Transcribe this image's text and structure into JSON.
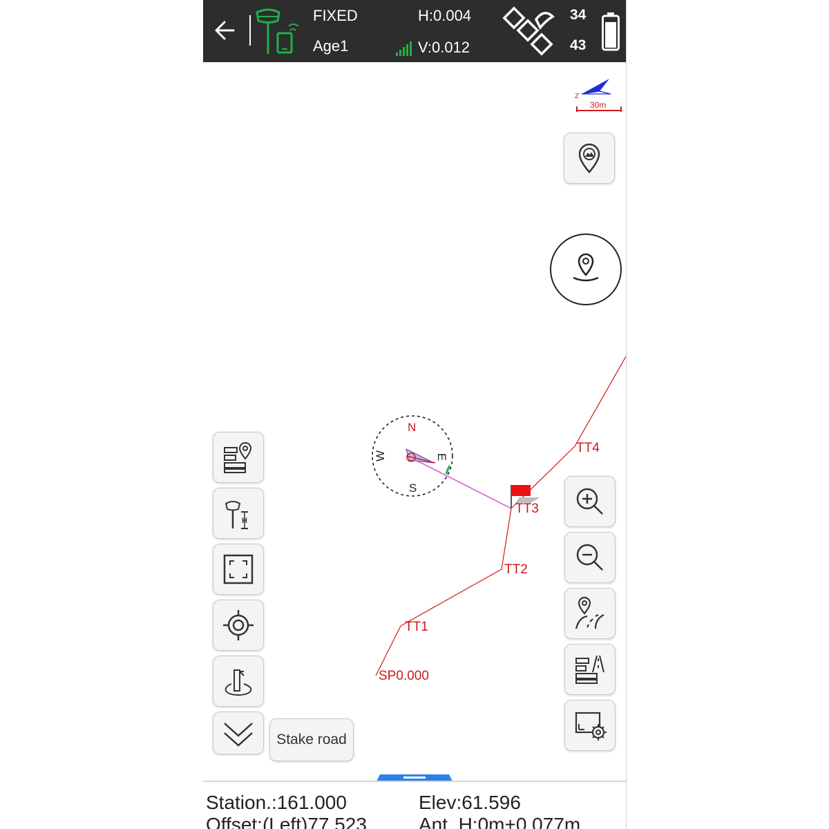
{
  "status_bar": {
    "solution": "FIXED",
    "age": "Age1",
    "h_precision": "H:0.004",
    "v_precision": "V:0.012",
    "satellites_used": "34",
    "satellites_visible": "43",
    "icons": {
      "back": "back-arrow-icon",
      "receiver": "gnss-receiver-icon",
      "signal": "signal-bars-icon",
      "satellite": "satellite-icon",
      "battery": "battery-icon"
    },
    "colors": {
      "background": "#2d2d2d",
      "receiver": "#22b04c",
      "signal": "#22b04c"
    }
  },
  "map": {
    "scale_label": "30m",
    "compass": {
      "north": "N",
      "south": "S",
      "east": "E",
      "west": "W"
    },
    "points": [
      {
        "label": "SP0.000"
      },
      {
        "label": "TT1"
      },
      {
        "label": "TT2"
      },
      {
        "label": "TT3"
      },
      {
        "label": "TT4"
      }
    ],
    "colors": {
      "alignment": "#d01818",
      "guide_line": "#cc55cc",
      "flag": "#ee1111"
    }
  },
  "left_tools": [
    {
      "icon": "layer-points-icon"
    },
    {
      "icon": "antenna-height-icon"
    },
    {
      "icon": "fit-view-icon"
    },
    {
      "icon": "center-position-icon"
    },
    {
      "icon": "stakeout-point-icon"
    },
    {
      "icon": "collapse-chevron-icon"
    }
  ],
  "right_tools": [
    {
      "icon": "base-map-icon"
    },
    {
      "icon": "zoom-in-icon"
    },
    {
      "icon": "zoom-out-icon"
    },
    {
      "icon": "road-stakeout-icon"
    },
    {
      "icon": "road-list-icon"
    },
    {
      "icon": "display-settings-icon"
    }
  ],
  "stake_road_label": "Stake road",
  "info_panel": {
    "station": "Station.:161.000",
    "elev": "Elev:61.596",
    "offset": "Offset:(Left)77.523",
    "ant_h": "Ant. H:0m+0.077m"
  }
}
